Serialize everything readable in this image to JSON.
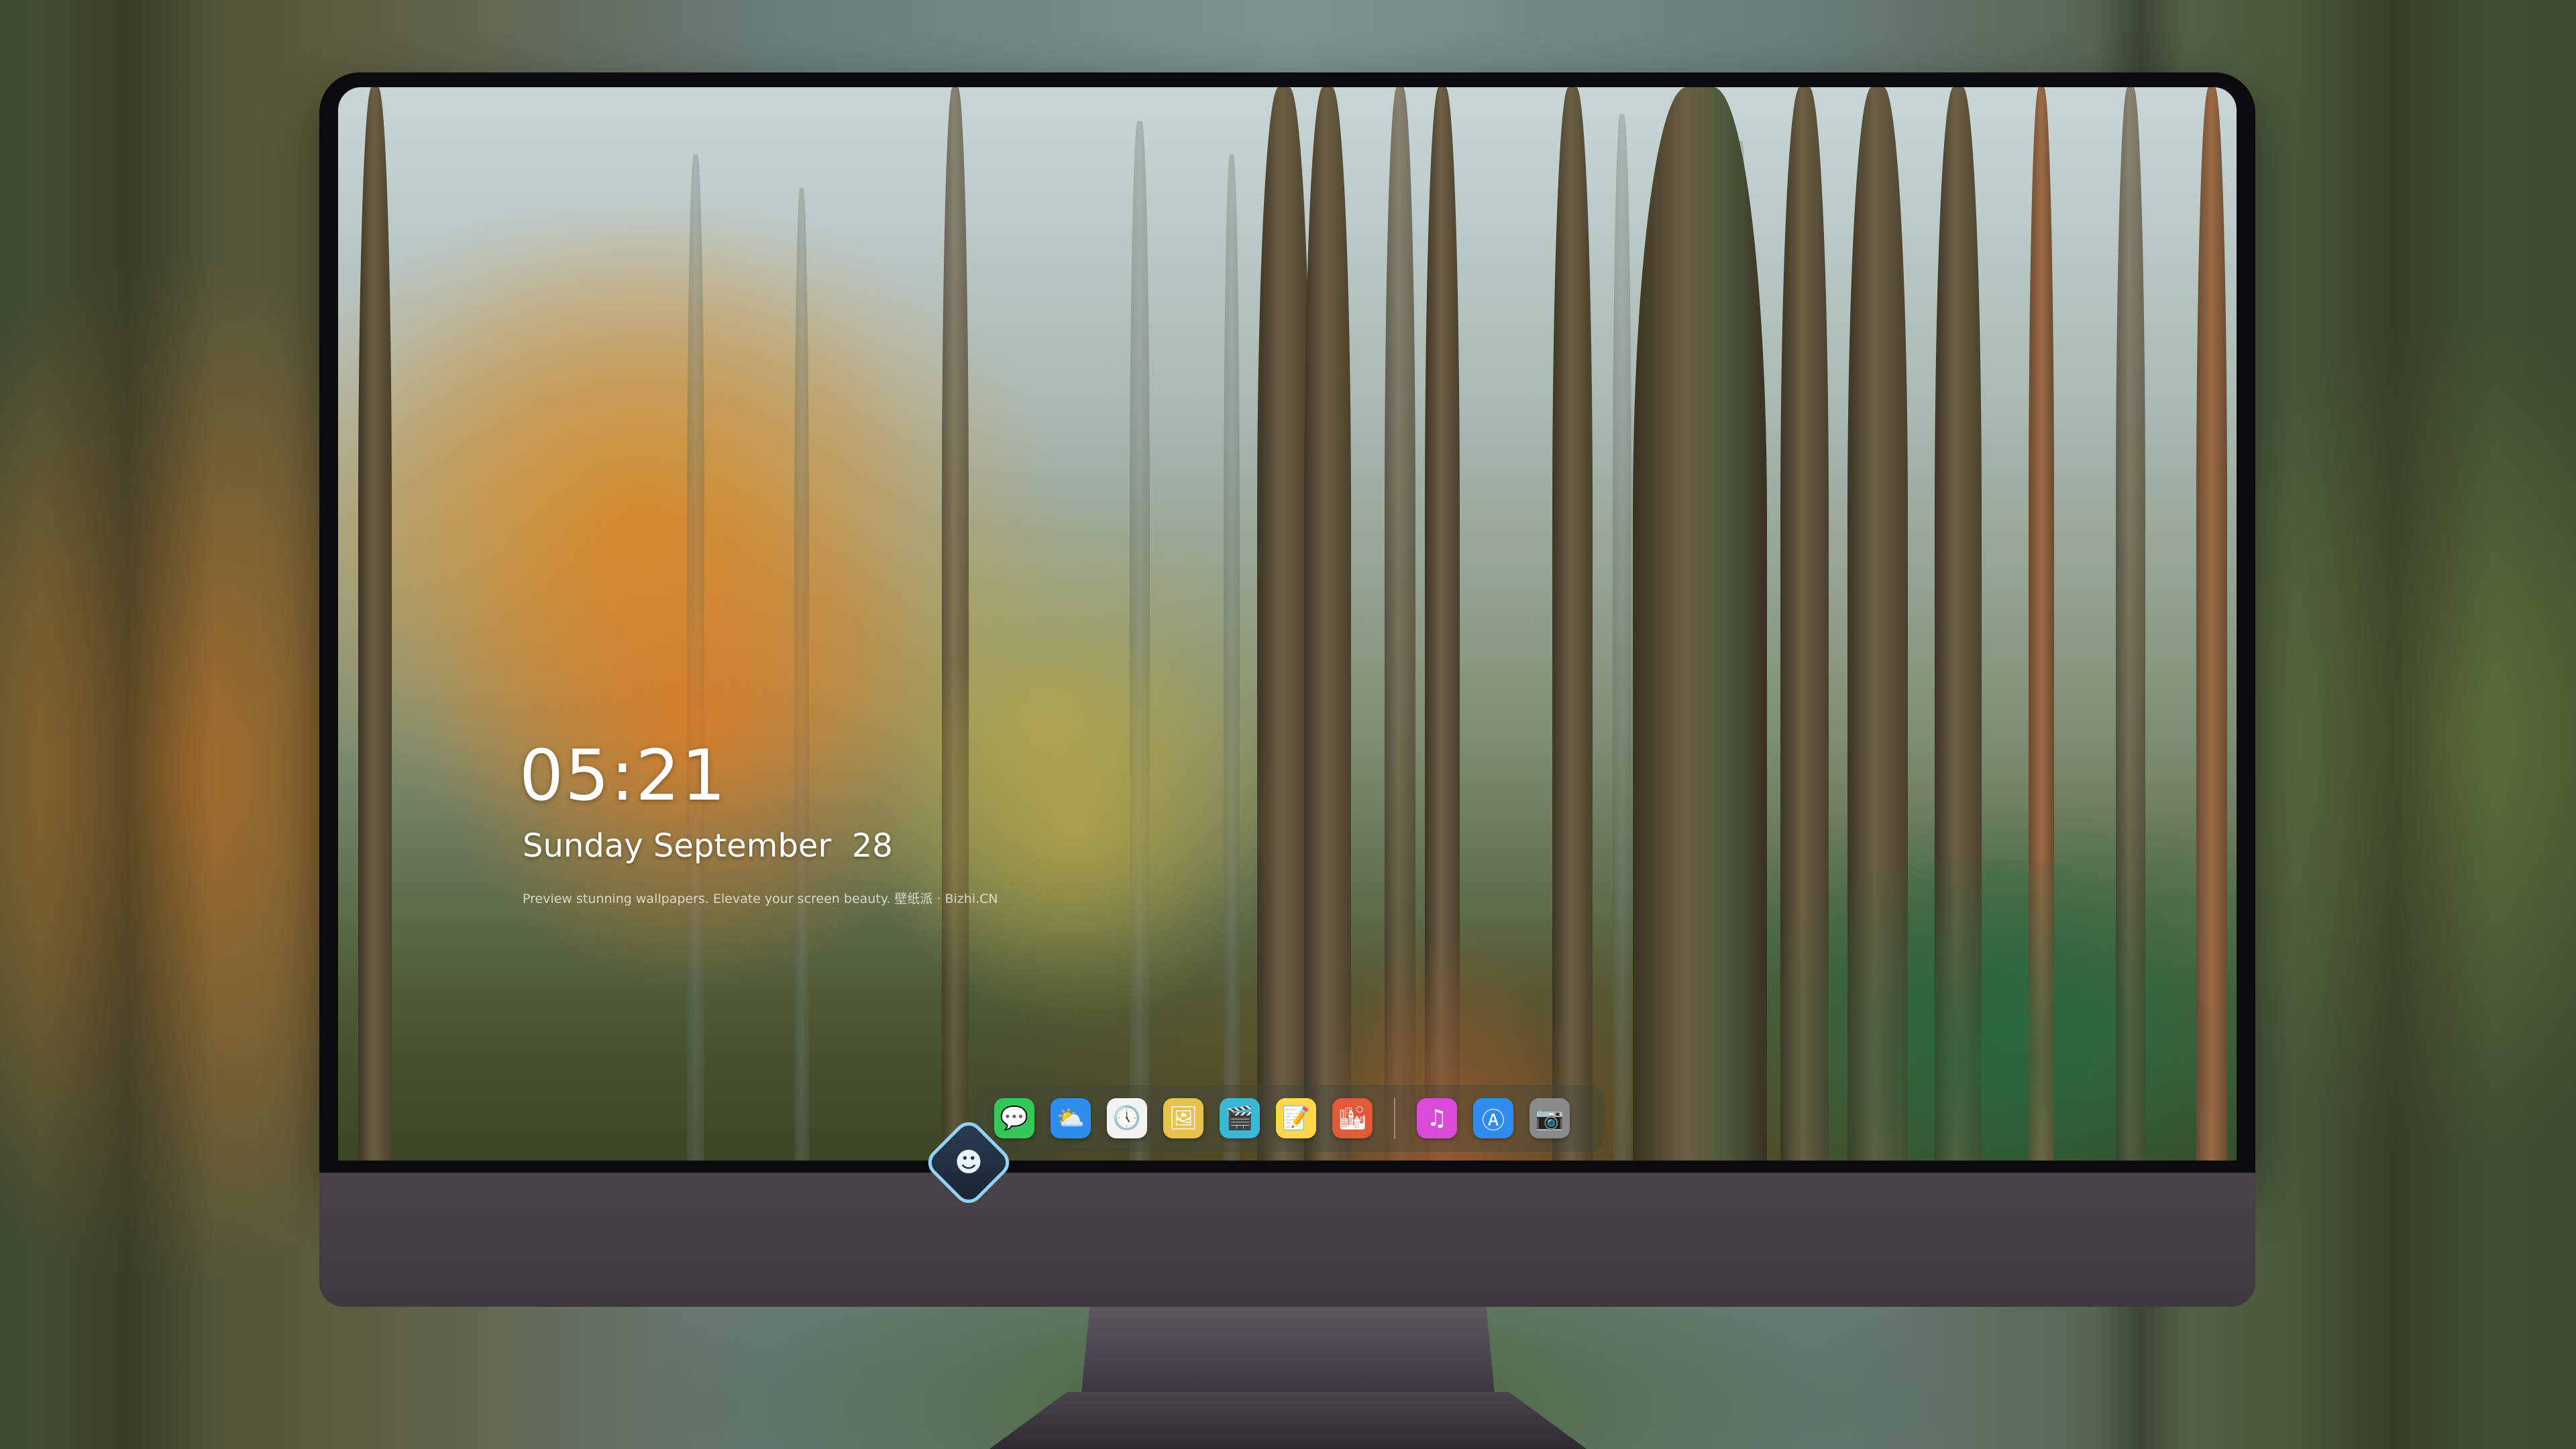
{
  "lockscreen": {
    "time": "05:21",
    "date": "Sunday September  28",
    "tagline": "Preview stunning wallpapers. Elevate your screen beauty. 壁纸派 · Bizhi.CN"
  },
  "dock": {
    "items": [
      {
        "name": "messages-icon",
        "glyph": "💬",
        "color": "#34c759"
      },
      {
        "name": "weather-icon",
        "glyph": "⛅",
        "color": "#2f8cf0"
      },
      {
        "name": "clock-icon",
        "glyph": "🕔",
        "color": "#f2f2f2"
      },
      {
        "name": "preview-icon",
        "glyph": "🖼",
        "color": "#e8c24a"
      },
      {
        "name": "video-icon",
        "glyph": "🎬",
        "color": "#3ab8d8"
      },
      {
        "name": "notes-icon",
        "glyph": "📝",
        "color": "#ffd84a"
      },
      {
        "name": "photos-icon",
        "glyph": "🏙",
        "color": "#e05a3a"
      },
      {
        "name": "itunes-icon",
        "glyph": "♫",
        "color": "#d94ad9"
      },
      {
        "name": "app-store-icon",
        "glyph": "Ⓐ",
        "color": "#2f8cf0"
      },
      {
        "name": "camera-icon",
        "glyph": "📷",
        "color": "#8a8a8a"
      }
    ]
  },
  "colors": {
    "chin": "#4a4249",
    "bezel": "#0b0b0d",
    "logo_accent": "#8fd4ff"
  }
}
